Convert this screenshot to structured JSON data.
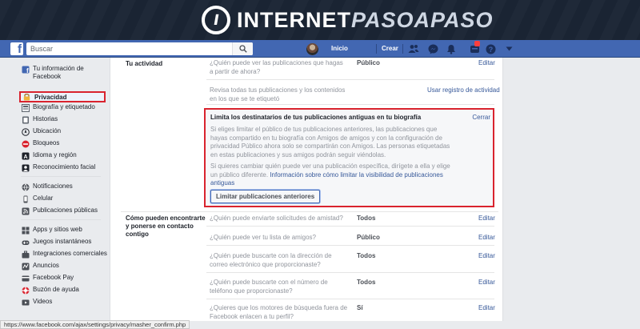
{
  "brand": {
    "part1": "INTERNET",
    "part2": "PASOAPASO",
    "logo_letter": "I"
  },
  "topbar": {
    "search_placeholder": "Buscar",
    "home": "Inicio",
    "create": "Crear",
    "notification_count": ""
  },
  "sidebar": {
    "items": [
      {
        "label": "Tu información de Facebook",
        "icon": "facebook-info-icon"
      },
      {
        "label": "Privacidad",
        "icon": "lock-icon",
        "active": true
      },
      {
        "label": "Biografía y etiquetado",
        "icon": "timeline-icon"
      },
      {
        "label": "Historias",
        "icon": "stories-icon"
      },
      {
        "label": "Ubicación",
        "icon": "location-icon"
      },
      {
        "label": "Bloqueos",
        "icon": "block-icon"
      },
      {
        "label": "Idioma y región",
        "icon": "language-icon"
      },
      {
        "label": "Reconocimiento facial",
        "icon": "face-icon"
      },
      {
        "label": "Notificaciones",
        "icon": "globe-icon"
      },
      {
        "label": "Celular",
        "icon": "mobile-icon"
      },
      {
        "label": "Publicaciones públicas",
        "icon": "rss-icon"
      },
      {
        "label": "Apps y sitios web",
        "icon": "apps-icon"
      },
      {
        "label": "Juegos instantáneos",
        "icon": "games-icon"
      },
      {
        "label": "Integraciones comerciales",
        "icon": "business-icon"
      },
      {
        "label": "Anuncios",
        "icon": "ads-icon"
      },
      {
        "label": "Facebook Pay",
        "icon": "pay-icon"
      },
      {
        "label": "Buzón de ayuda",
        "icon": "help-inbox-icon"
      },
      {
        "label": "Videos",
        "icon": "video-icon"
      }
    ]
  },
  "activity": {
    "section_label": "Tu actividad",
    "q1": "¿Quién puede ver las publicaciones que hagas a partir de ahora?",
    "q1_value": "Público",
    "q1_edit": "Editar",
    "q2": "Revisa todas tus publicaciones y los contenidos en los que se te etiquetó",
    "q2_link": "Usar registro de actividad"
  },
  "limit_box": {
    "title": "Limita los destinatarios de tus publicaciones antiguas en tu biografía",
    "close": "Cerrar",
    "p1": "Si eliges limitar el público de tus publicaciones anteriores, las publicaciones que hayas compartido en tu biografía con Amigos de amigos y con la configuración de privacidad Público ahora solo se compartirán con Amigos. Las personas etiquetadas en estas publicaciones y sus amigos podrán seguir viéndolas.",
    "p2": "Si quieres cambiar quién puede ver una publicación específica, dirígete a ella y elige un público diferente.",
    "p2_link": "Información sobre cómo limitar la visibilidad de publicaciones antiguas",
    "button": "Limitar publicaciones anteriores"
  },
  "contact": {
    "section_label": "Cómo pueden encontrarte y ponerse en contacto contigo",
    "rows": [
      {
        "q": "¿Quién puede enviarte solicitudes de amistad?",
        "value": "Todos",
        "edit": "Editar"
      },
      {
        "q": "¿Quién puede ver tu lista de amigos?",
        "value": "Público",
        "edit": "Editar"
      },
      {
        "q": "¿Quién puede buscarte con la dirección de correo electrónico que proporcionaste?",
        "value": "Todos",
        "edit": "Editar"
      },
      {
        "q": "¿Quién puede buscarte con el número de teléfono que proporcionaste?",
        "value": "Todos",
        "edit": "Editar"
      },
      {
        "q": "¿Quieres que los motores de búsqueda fuera de Facebook enlacen a tu perfil?",
        "value": "Sí",
        "edit": "Editar"
      }
    ]
  },
  "status_url": "https://www.facebook.com/ajax/settings/privacy/masher_confirm.php",
  "colors": {
    "fb_blue": "#4267b2",
    "highlight_red": "#d9232e",
    "link": "#365899"
  }
}
